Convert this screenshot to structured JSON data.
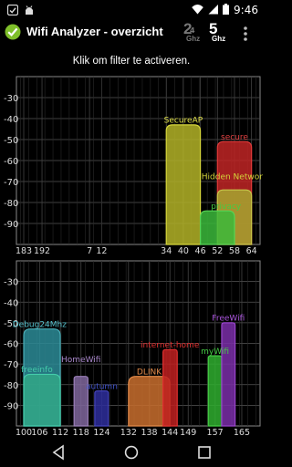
{
  "status_bar": {
    "time": "9:46"
  },
  "app_bar": {
    "title": "Wifi Analyzer - overzicht",
    "band_24": {
      "num": "2",
      "sup": "4",
      "unit": "Ghz"
    },
    "band_5": {
      "num": "5",
      "unit": "Ghz"
    }
  },
  "hint": "Klik om filter te activeren.",
  "chart_data": [
    {
      "type": "area",
      "ylim": [
        -100,
        -20
      ],
      "yticks": [
        -30,
        -40,
        -50,
        -60,
        -70,
        -80,
        -90
      ],
      "xlim": [
        181,
        65
      ],
      "xticks": [
        {
          "label": "183",
          "pos": 0.03
        },
        {
          "label": "192",
          "pos": 0.105
        },
        {
          "label": "7",
          "pos": 0.3
        },
        {
          "label": "12",
          "pos": 0.35
        },
        {
          "label": "34",
          "pos": 0.615
        },
        {
          "label": "40",
          "pos": 0.685
        },
        {
          "label": "46",
          "pos": 0.755
        },
        {
          "label": "52",
          "pos": 0.825
        },
        {
          "label": "58",
          "pos": 0.895
        },
        {
          "label": "64",
          "pos": 0.965
        }
      ],
      "networks": [
        {
          "name": "SecureAP",
          "ch_from": 34,
          "ch_to": 46,
          "top": -43,
          "color": "#d4d43a",
          "fill": "#b3b327"
        },
        {
          "name": "Hidden Network",
          "ch_from": 52,
          "ch_to": 64,
          "top": -51,
          "color": "#e03a3a",
          "fill": "#c02525"
        },
        {
          "name": "",
          "ch_from": 52,
          "ch_to": 64,
          "top": -74,
          "color": "#c8c84a",
          "fill": "#a7a730"
        },
        {
          "name": "",
          "ch_from": 46,
          "ch_to": 58,
          "top": -84,
          "color": "#55d455",
          "fill": "#3bb83b"
        }
      ],
      "labels": [
        {
          "text": "SecureAP",
          "ch": 40,
          "at": -42,
          "color": "#e2e24a"
        },
        {
          "text": "secure",
          "ch": 58,
          "at": -50,
          "color": "#e04040"
        },
        {
          "text": "Hidden Network",
          "ch": 58,
          "at": -69,
          "color": "#d4d43a"
        },
        {
          "text": "privacy",
          "ch": 55,
          "at": -83,
          "color": "#44cc44"
        }
      ]
    },
    {
      "type": "area",
      "ylim": [
        -100,
        -20
      ],
      "yticks": [
        -30,
        -40,
        -50,
        -60,
        -70,
        -80,
        -90
      ],
      "xticks": [
        {
          "label": "100",
          "pos": 0.03
        },
        {
          "label": "106",
          "pos": 0.095
        },
        {
          "label": "112",
          "pos": 0.18
        },
        {
          "label": "118",
          "pos": 0.265
        },
        {
          "label": "124",
          "pos": 0.35
        },
        {
          "label": "132",
          "pos": 0.46
        },
        {
          "label": "138",
          "pos": 0.545
        },
        {
          "label": "144",
          "pos": 0.63
        },
        {
          "label": "149",
          "pos": 0.705
        },
        {
          "label": "157",
          "pos": 0.815
        },
        {
          "label": "165",
          "pos": 0.925
        }
      ],
      "networks": [
        {
          "name": "Debug24Mhz",
          "ch_from": 100,
          "ch_to": 112,
          "top": -53,
          "color": "#4aaeb8",
          "fill": "#2c8b96"
        },
        {
          "name": "freeinfo",
          "ch_from": 100,
          "ch_to": 112,
          "top": -75,
          "color": "#44ccaa",
          "fill": "#32a887"
        },
        {
          "name": "HomeWifi",
          "ch_from": 116,
          "ch_to": 120,
          "top": -76,
          "color": "#9a7fb8",
          "fill": "#7f669c"
        },
        {
          "name": "autumn",
          "ch_from": 122,
          "ch_to": 126,
          "top": -83,
          "color": "#4444bb",
          "fill": "#2e2e9c"
        },
        {
          "name": "DLINK",
          "ch_from": 132,
          "ch_to": 144,
          "top": -76,
          "color": "#e28a4a",
          "fill": "#c96e2e"
        },
        {
          "name": "internet-home",
          "ch_from": 142,
          "ch_to": 146,
          "top": -63,
          "color": "#e03030",
          "fill": "#c02020"
        },
        {
          "name": "myWifi",
          "ch_from": 155,
          "ch_to": 159,
          "top": -66,
          "color": "#44cc44",
          "fill": "#2fae2f"
        },
        {
          "name": "FreeWifi",
          "ch_from": 159,
          "ch_to": 163,
          "top": -50,
          "color": "#9944cc",
          "fill": "#7a2ea8"
        }
      ],
      "labels": [
        {
          "text": "Debug24Mhz",
          "ch": 106,
          "at": -52,
          "color": "#55c0cc"
        },
        {
          "text": "freeinfo",
          "ch": 105,
          "at": -74,
          "color": "#44ccaa"
        },
        {
          "text": "HomeWifi",
          "ch": 118,
          "at": -69,
          "color": "#aa88cc"
        },
        {
          "text": "autumn",
          "ch": 124,
          "at": -82,
          "color": "#4455cc"
        },
        {
          "text": "DLINK",
          "ch": 138,
          "at": -75,
          "color": "#e28a4a"
        },
        {
          "text": "internet-home",
          "ch": 144,
          "at": -62,
          "color": "#e03030"
        },
        {
          "text": "myWifi",
          "ch": 157,
          "at": -65,
          "color": "#44cc44"
        },
        {
          "text": "FreeWifi",
          "ch": 161,
          "at": -49,
          "color": "#aa55dd"
        }
      ]
    }
  ]
}
